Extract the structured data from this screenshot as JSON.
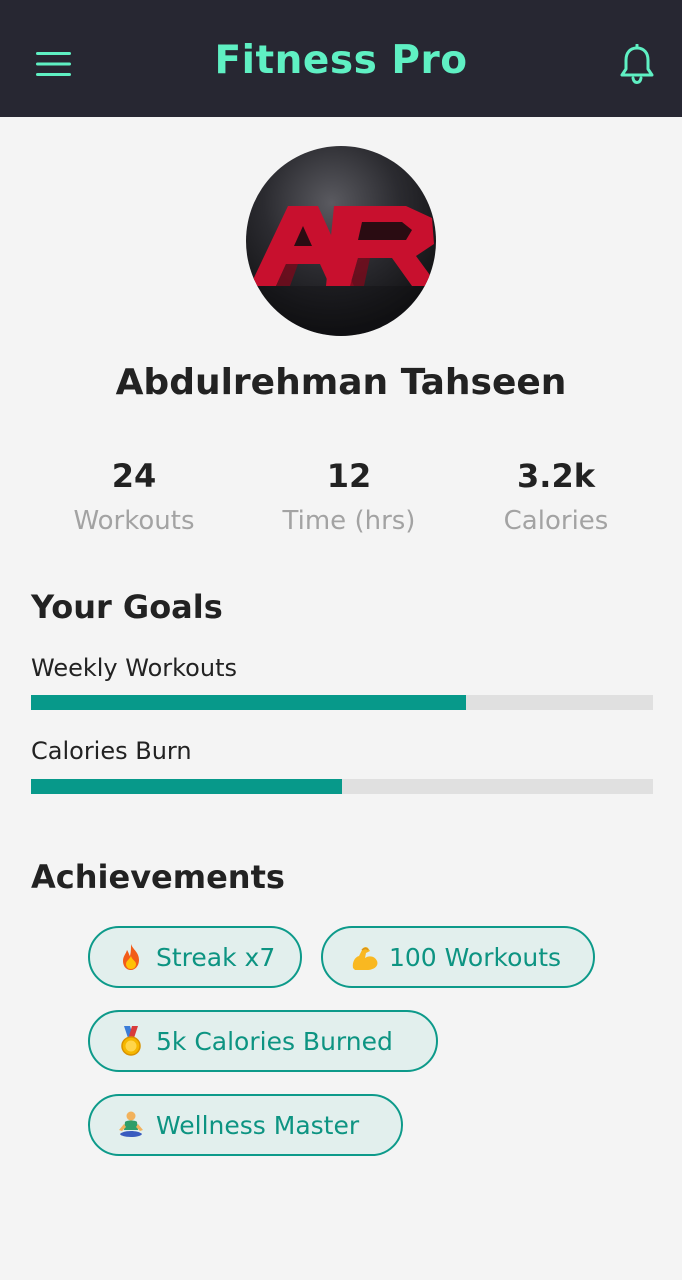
{
  "header": {
    "title": "Fitness Pro",
    "accent_color": "#5ff0c3",
    "background_color": "#272732",
    "menu_icon": "hamburger-menu-icon",
    "notification_icon": "bell-icon"
  },
  "profile": {
    "name": "Abdulrehman Tahseen",
    "avatar_icon": "ar-logo-avatar"
  },
  "stats": [
    {
      "value": "24",
      "label": "Workouts"
    },
    {
      "value": "12",
      "label": "Time (hrs)"
    },
    {
      "value": "3.2k",
      "label": "Calories"
    }
  ],
  "goals": {
    "title": "Your Goals",
    "items": [
      {
        "label": "Weekly Workouts",
        "progress": 0.7
      },
      {
        "label": "Calories Burn",
        "progress": 0.5
      }
    ],
    "bar_color": "#07998a"
  },
  "achievements": {
    "title": "Achievements",
    "items": [
      {
        "icon": "fire-icon",
        "label": "Streak x7"
      },
      {
        "icon": "flexed-biceps-icon",
        "label": "100 Workouts"
      },
      {
        "icon": "medal-icon",
        "label": "5k Calories Burned"
      },
      {
        "icon": "meditation-icon",
        "label": "Wellness Master"
      }
    ]
  }
}
